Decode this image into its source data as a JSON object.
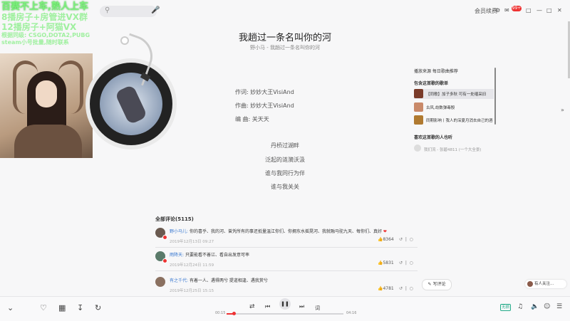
{
  "overlay": {
    "line1": "百赛不上车,熟人上车",
    "line2": "8播房子+房管进VX群",
    "line3": "12播房子+阿猫VX",
    "line4": "根据同级: CSGO,DOTA2,PUBG",
    "line5": "steam小号批量,随时联系"
  },
  "topbar": {
    "mic_icon": "microphone-icon",
    "vip_label": "会员续费",
    "mail_badge": "99+"
  },
  "song": {
    "title": "我趟过一条名叫你的河",
    "subtitle": "野小马 - 我趟过一条名叫你的河",
    "credits": [
      "作词: 妙妙大王VisiAnd",
      "作曲: 妙妙大王VisiAnd",
      "编  曲: 关天天"
    ],
    "lyrics": [
      "丹桥过湖畔",
      "泛起的涟漪沃汲",
      "谁与我同行为伴",
      "谁与我关关"
    ]
  },
  "right_panel": {
    "tabs_label": "播放来源  每日歌曲推荐",
    "playlists_label": "包含这首歌的歌单",
    "playlists": [
      {
        "name": "【同歌】加子多秋 可有一处缅采旧",
        "color": "#7a3b2a"
      },
      {
        "name": "古风,劫数弹毒殷",
        "color": "#c98a6a"
      },
      {
        "name": "同期影响丨我人的深夏月消去自己的酒",
        "color": "#b07a30"
      }
    ],
    "listeners_label": "喜欢这首歌的人也听",
    "listener": "我们流 - 张碧4811 (一个大全景)"
  },
  "comments": {
    "title": "全部评论(5115)",
    "items": [
      {
        "user": "野小马儿:",
        "text": "你的喜乎、我的河、曾凭所有的事还抵量温江你们、你拥东水摇晃河、我就融马驼九天、每你们、真好",
        "time": "2019年12月13日 09:27",
        "likes": "8364",
        "avatar": "#6a5a50"
      },
      {
        "user": "雨降天:",
        "text": "只要能看不善讧、看自出发意可率",
        "time": "2019年12月24日 11:59",
        "likes": "5831",
        "avatar": "#5a7a6a"
      },
      {
        "user": "有之千代:",
        "text": "有着一人、遇得两兮 提道相逢、遇我赏兮",
        "time": "2019年12月25日 15:15",
        "likes": "4781",
        "avatar": "#8a7060"
      }
    ],
    "write_label": "写评论"
  },
  "notice": {
    "text": "有人关注..."
  },
  "player": {
    "time_current": "00:15",
    "time_total": "04:16",
    "progress": 0.06,
    "lyrics_btn": "词",
    "quality": "无损"
  }
}
